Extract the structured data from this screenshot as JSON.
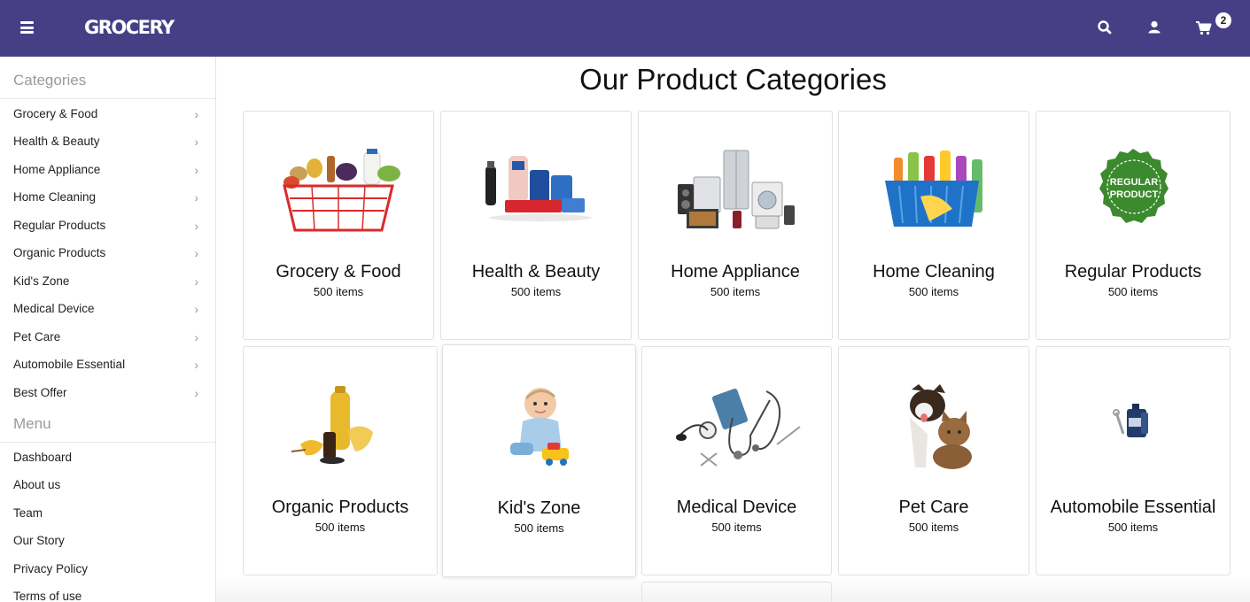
{
  "header": {
    "logo": "GROCERY",
    "cart_count": "2"
  },
  "sidebar": {
    "categories_heading": "Categories",
    "categories": [
      {
        "label": "Grocery & Food"
      },
      {
        "label": "Health & Beauty"
      },
      {
        "label": "Home Appliance"
      },
      {
        "label": "Home Cleaning"
      },
      {
        "label": "Regular Products"
      },
      {
        "label": "Organic Products"
      },
      {
        "label": "Kid's Zone"
      },
      {
        "label": "Medical Device"
      },
      {
        "label": "Pet Care"
      },
      {
        "label": "Automobile Essential"
      },
      {
        "label": "Best Offer"
      }
    ],
    "menu_heading": "Menu",
    "menu": [
      {
        "label": "Dashboard"
      },
      {
        "label": "About us"
      },
      {
        "label": "Team"
      },
      {
        "label": "Our Story"
      },
      {
        "label": "Privacy Policy"
      },
      {
        "label": "Terms of use"
      }
    ]
  },
  "main": {
    "title": "Our Product Categories",
    "cards": [
      {
        "name": "Grocery & Food",
        "count": "500 items",
        "icon": "grocery-basket-image"
      },
      {
        "name": "Health & Beauty",
        "count": "500 items",
        "icon": "health-beauty-products-image"
      },
      {
        "name": "Home Appliance",
        "count": "500 items",
        "icon": "home-appliances-image"
      },
      {
        "name": "Home Cleaning",
        "count": "500 items",
        "icon": "cleaning-supplies-basket-image"
      },
      {
        "name": "Regular Products",
        "count": "500 items",
        "icon": "regular-product-badge-image",
        "badge_text": "REGULAR PRODUCT"
      },
      {
        "name": "Organic Products",
        "count": "500 items",
        "icon": "organic-oil-image"
      },
      {
        "name": "Kid's Zone",
        "count": "500 items",
        "icon": "baby-with-toy-car-image"
      },
      {
        "name": "Medical Device",
        "count": "500 items",
        "icon": "medical-instruments-image"
      },
      {
        "name": "Pet Care",
        "count": "500 items",
        "icon": "dog-and-cat-image"
      },
      {
        "name": "Automobile Essential",
        "count": "500 items",
        "icon": "motor-oil-can-image"
      }
    ]
  },
  "colors": {
    "header_bg": "#473f86",
    "badge_green": "#3c8a2e"
  }
}
